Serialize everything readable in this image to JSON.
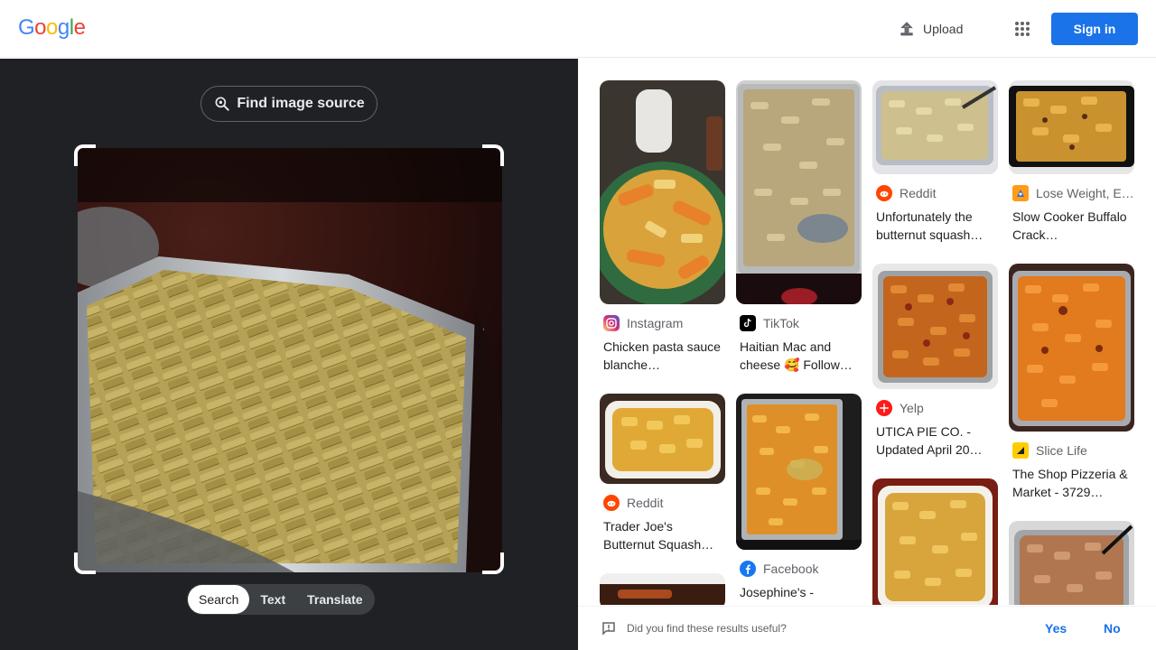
{
  "header": {
    "logo_letters": [
      "G",
      "o",
      "o",
      "g",
      "l",
      "e"
    ],
    "logo_colors": [
      "#4285f4",
      "#ea4335",
      "#fbbc05",
      "#4285f4",
      "#34a853",
      "#ea4335"
    ],
    "upload_label": "Upload",
    "signin_label": "Sign in",
    "accent": "#1a73e8"
  },
  "left": {
    "find_source_label": "Find image source",
    "modes": [
      "Search",
      "Text",
      "Translate"
    ],
    "active_mode": "Search"
  },
  "results": [
    [
      {
        "source": "Instagram",
        "source_icon": "instagram-icon",
        "title": "Chicken pasta sauce blanche…"
      },
      {
        "source": "Reddit",
        "source_icon": "reddit-icon",
        "title": "Trader Joe's Butternut Squash…"
      }
    ],
    [
      {
        "source": "TikTok",
        "source_icon": "tiktok-icon",
        "title": "Haitian Mac and cheese 🥰 Follow…"
      },
      {
        "source": "Facebook",
        "source_icon": "facebook-icon",
        "title": "Josephine's -"
      }
    ],
    [
      {
        "source": "Reddit",
        "source_icon": "reddit-icon",
        "title": "Unfortunately the butternut squash…"
      },
      {
        "source": "Yelp",
        "source_icon": "yelp-icon",
        "title": "UTICA PIE CO. - Updated April 20…"
      }
    ],
    [
      {
        "source": "Lose Weight, E…",
        "source_icon": "loseit-icon",
        "title": "Slow Cooker Buffalo Crack…"
      },
      {
        "source": "Slice Life",
        "source_icon": "slice-icon",
        "title": "The Shop Pizzeria & Market - 3729…"
      }
    ]
  ],
  "feedback": {
    "question": "Did you find these results useful?",
    "yes": "Yes",
    "no": "No"
  }
}
